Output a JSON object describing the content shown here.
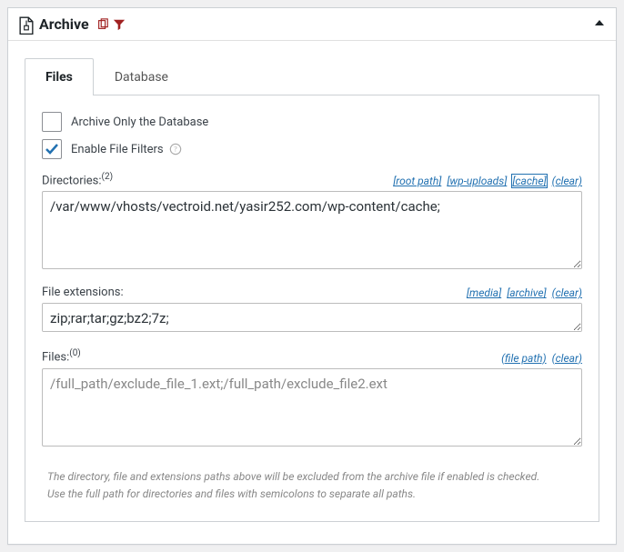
{
  "header": {
    "title": "Archive"
  },
  "tabs": {
    "files": "Files",
    "database": "Database"
  },
  "checks": {
    "archive_only_db": "Archive Only the Database",
    "enable_file_filters": "Enable File Filters"
  },
  "directories": {
    "label": "Directories:",
    "count_sup": "(2)",
    "links": {
      "root": "[root path]",
      "wpuploads": "[wp-uploads]",
      "cache": "[cache]",
      "clear": "(clear)"
    },
    "value": "/var/www/vhosts/vectroid.net/yasir252.com/wp-content/cache;"
  },
  "extensions": {
    "label": "File extensions:",
    "links": {
      "media": "[media]",
      "archive": "[archive]",
      "clear": "(clear)"
    },
    "value": "zip;rar;tar;gz;bz2;7z;"
  },
  "files": {
    "label": "Files:",
    "count_sup": "(0)",
    "links": {
      "filepath": "(file path)",
      "clear": "(clear)"
    },
    "placeholder": "/full_path/exclude_file_1.ext;/full_path/exclude_file2.ext"
  },
  "footnote": {
    "line1": "The directory, file and extensions paths above will be excluded from the archive file if enabled is checked.",
    "line2": "Use the full path for directories and files with semicolons to separate all paths."
  }
}
